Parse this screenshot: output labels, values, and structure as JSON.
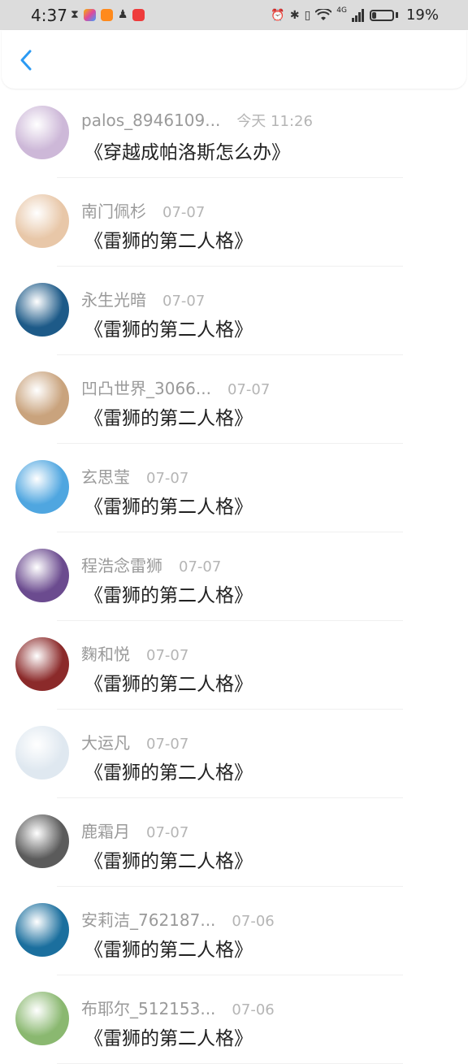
{
  "status_bar": {
    "time": "4:37",
    "battery_text": "19%",
    "battery_level": 0.19,
    "network_label": "4G"
  },
  "header": {
    "back_icon": "chevron-left-icon",
    "accent_color": "#2b9af3"
  },
  "messages": [
    {
      "name": "palos_8946109...",
      "time": "今天 11:26",
      "content": "《穿越成帕洛斯怎么办》",
      "avatar_color": "#cdb8d8"
    },
    {
      "name": "南门佩杉",
      "time": "07-07",
      "content": "《雷狮的第二人格》",
      "avatar_color": "#e8c7a8"
    },
    {
      "name": "永生光暗",
      "time": "07-07",
      "content": "《雷狮的第二人格》",
      "avatar_color": "#1d5a88"
    },
    {
      "name": "凹凸世界_3066...",
      "time": "07-07",
      "content": "《雷狮的第二人格》",
      "avatar_color": "#c9a37d"
    },
    {
      "name": "玄思莹",
      "time": "07-07",
      "content": "《雷狮的第二人格》",
      "avatar_color": "#4fa6e0"
    },
    {
      "name": "程浩念雷狮",
      "time": "07-07",
      "content": "《雷狮的第二人格》",
      "avatar_color": "#6b4b8f"
    },
    {
      "name": "麴和悦",
      "time": "07-07",
      "content": "《雷狮的第二人格》",
      "avatar_color": "#8b2a2a"
    },
    {
      "name": "大运凡",
      "time": "07-07",
      "content": "《雷狮的第二人格》",
      "avatar_color": "#dfe8f0"
    },
    {
      "name": "鹿霜月",
      "time": "07-07",
      "content": "《雷狮的第二人格》",
      "avatar_color": "#5b5b5b"
    },
    {
      "name": "安莉洁_762187...",
      "time": "07-06",
      "content": "《雷狮的第二人格》",
      "avatar_color": "#1b6f9e"
    },
    {
      "name": "布耶尔_512153...",
      "time": "07-06",
      "content": "《雷狮的第二人格》",
      "avatar_color": "#8ab870"
    }
  ]
}
